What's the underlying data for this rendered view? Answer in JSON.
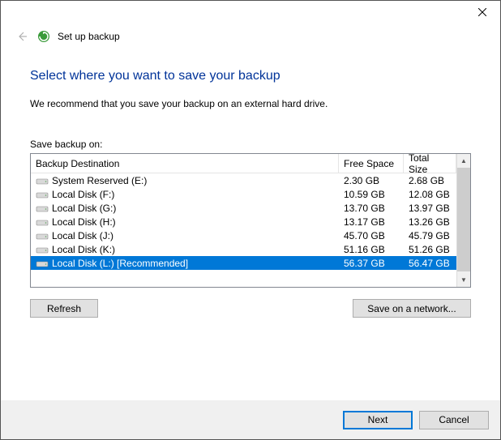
{
  "titlebar": {
    "wizard_title": "Set up backup"
  },
  "content": {
    "heading": "Select where you want to save your backup",
    "subtext": "We recommend that you save your backup on an external hard drive.",
    "list_label": "Save backup on:"
  },
  "list": {
    "headers": {
      "destination": "Backup Destination",
      "free": "Free Space",
      "total": "Total Size"
    },
    "rows": [
      {
        "name": "System Reserved (E:)",
        "free": "2.30 GB",
        "total": "2.68 GB",
        "selected": false
      },
      {
        "name": "Local Disk (F:)",
        "free": "10.59 GB",
        "total": "12.08 GB",
        "selected": false
      },
      {
        "name": "Local Disk (G:)",
        "free": "13.70 GB",
        "total": "13.97 GB",
        "selected": false
      },
      {
        "name": "Local Disk (H:)",
        "free": "13.17 GB",
        "total": "13.26 GB",
        "selected": false
      },
      {
        "name": "Local Disk (J:)",
        "free": "45.70 GB",
        "total": "45.79 GB",
        "selected": false
      },
      {
        "name": "Local Disk (K:)",
        "free": "51.16 GB",
        "total": "51.26 GB",
        "selected": false
      },
      {
        "name": "Local Disk (L:) [Recommended]",
        "free": "56.37 GB",
        "total": "56.47 GB",
        "selected": true
      }
    ]
  },
  "buttons": {
    "refresh": "Refresh",
    "save_network": "Save on a network...",
    "next": "Next",
    "cancel": "Cancel"
  }
}
